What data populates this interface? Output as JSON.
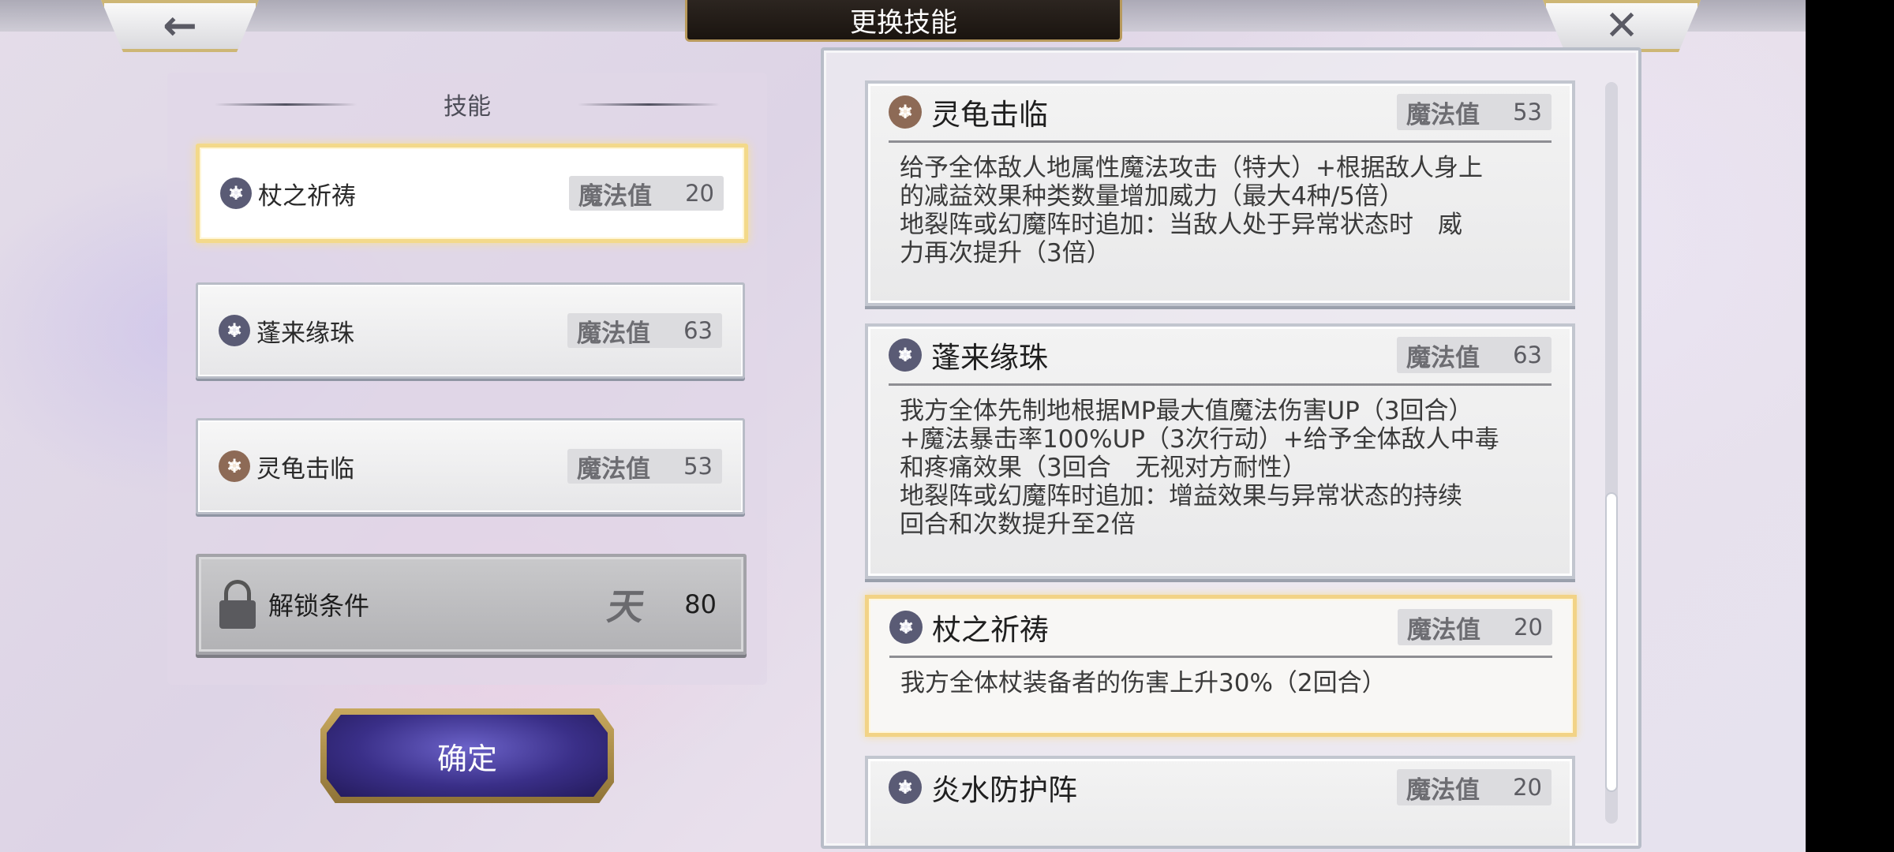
{
  "window": {
    "title": "更换技能"
  },
  "nav": {
    "back_icon": "←",
    "close_icon": "✕"
  },
  "left_panel": {
    "header": "技能",
    "slots": [
      {
        "name": "杖之祈祷",
        "mp_label": "魔法值",
        "mp": "20",
        "icon": "wind-icon",
        "selected": true
      },
      {
        "name": "蓬来缘珠",
        "mp_label": "魔法值",
        "mp": "63",
        "icon": "wind-icon",
        "selected": false
      },
      {
        "name": "灵龟击临",
        "mp_label": "魔法值",
        "mp": "53",
        "icon": "earth-icon",
        "selected": false
      }
    ],
    "locked_slot": {
      "label": "解锁条件",
      "glyph": "天",
      "value": "80"
    },
    "confirm_label": "确定"
  },
  "right_panel": {
    "cards": [
      {
        "name": "灵龟击临",
        "mp_label": "魔法值",
        "mp": "53",
        "icon": "earth-icon",
        "desc": "给予全体敌人地属性魔法攻击（特大）+根据敌人身上\n的减益效果种类数量增加威力（最大4种/5倍）\n地裂阵或幻魔阵时追加：当敌人处于异常状态时　威\n力再次提升（3倍）"
      },
      {
        "name": "蓬来缘珠",
        "mp_label": "魔法值",
        "mp": "63",
        "icon": "wind-icon",
        "desc": "我方全体先制地根据MP最大值魔法伤害UP（3回合）\n+魔法暴击率100%UP（3次行动）+给予全体敌人中毒\n和疼痛效果（3回合　无视对方耐性）\n地裂阵或幻魔阵时追加：增益效果与异常状态的持续\n回合和次数提升至2倍"
      },
      {
        "name": "杖之祈祷",
        "mp_label": "魔法值",
        "mp": "20",
        "icon": "wind-icon",
        "desc": "我方全体杖装备者的伤害上升30%（2回合）"
      },
      {
        "name": "炎水防护阵",
        "mp_label": "魔法值",
        "mp": "20",
        "icon": "wind-icon",
        "desc": ""
      }
    ]
  },
  "colors": {
    "highlight": "#f2d386",
    "confirm": "#3a2f88",
    "title_bar": "#1a140f"
  }
}
